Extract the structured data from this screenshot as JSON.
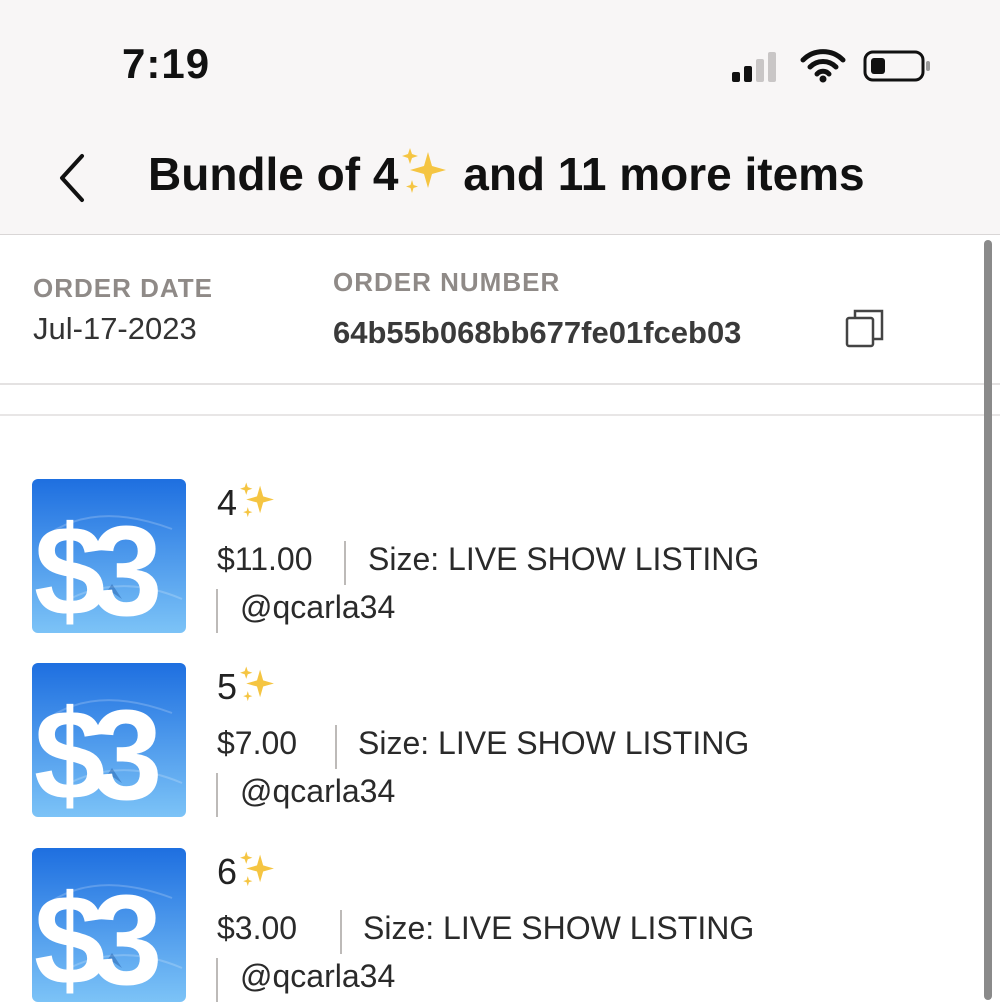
{
  "status_bar": {
    "time": "7:19",
    "icons": [
      "cellular-signal-icon",
      "wifi-icon",
      "battery-icon"
    ]
  },
  "header": {
    "title_prefix": "Bundle of 4",
    "title_emoji": "sparkles-icon",
    "title_suffix": "and 11 more items",
    "back_icon": "chevron-left-icon"
  },
  "order": {
    "date_label": "ORDER DATE",
    "date_value": "Jul-17-2023",
    "number_label": "ORDER NUMBER",
    "number_value": "64b55b068bb677fe01fceb03",
    "copy_icon": "copy-icon"
  },
  "items": [
    {
      "thumb_text": "$3",
      "name": "4",
      "price": "$11.00",
      "size": "Size: LIVE SHOW LISTING",
      "seller": "@qcarla34"
    },
    {
      "thumb_text": "$3",
      "name": "5",
      "price": "$7.00",
      "size": "Size: LIVE SHOW LISTING",
      "seller": "@qcarla34"
    },
    {
      "thumb_text": "$3",
      "name": "6",
      "price": "$3.00",
      "size": "Size: LIVE SHOW LISTING",
      "seller": "@qcarla34"
    }
  ],
  "colors": {
    "header_bg": "#f8f6f6",
    "label_gray": "#8f8a87",
    "thumb_blue_top": "#1e6fe0",
    "thumb_blue_bottom": "#7cc3f7",
    "sparkle_yellow": "#f5c542"
  }
}
